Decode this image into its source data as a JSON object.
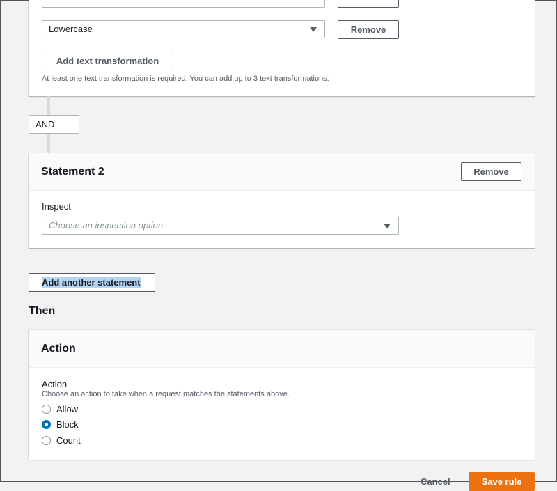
{
  "statement1": {
    "transform_value": "Lowercase",
    "remove_label": "Remove",
    "add_transform_label": "Add text transformation",
    "hint": "At least one text transformation is required. You can add up to 3 text transformations."
  },
  "connector": {
    "label": "AND"
  },
  "statement2": {
    "title": "Statement 2",
    "remove_label": "Remove",
    "inspect_label": "Inspect",
    "inspect_placeholder": "Choose an inspection option"
  },
  "add_statement_label": "Add another statement",
  "then_heading": "Then",
  "action_panel": {
    "title": "Action",
    "field_label": "Action",
    "field_hint": "Choose an action to take when a request matches the statements above.",
    "options": [
      {
        "label": "Allow",
        "selected": false
      },
      {
        "label": "Block",
        "selected": true
      },
      {
        "label": "Count",
        "selected": false
      }
    ]
  },
  "footer": {
    "cancel_label": "Cancel",
    "save_label": "Save rule"
  },
  "colors": {
    "accent": "#0073bb",
    "primary_button": "#ec7211",
    "selection_highlight": "#b3d4f5"
  }
}
